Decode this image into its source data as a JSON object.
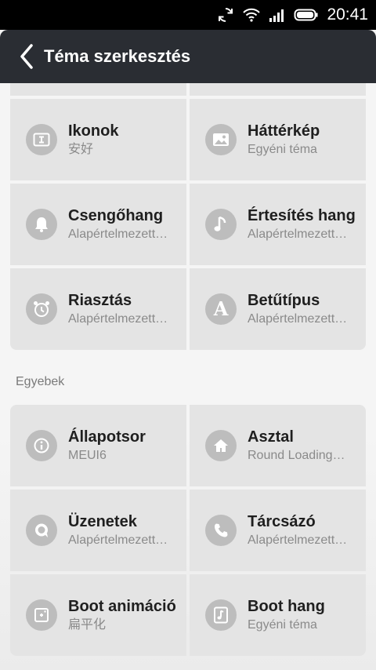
{
  "status_bar": {
    "time": "20:41"
  },
  "header": {
    "title": "Téma szerkesztés"
  },
  "top_group": [
    {
      "name": "",
      "sub": ""
    },
    {
      "name": "",
      "sub": ""
    },
    {
      "name": "Ikonok",
      "sub": "安好",
      "icon": "icons-icon"
    },
    {
      "name": "Háttérkép",
      "sub": "Egyéni téma",
      "icon": "wallpaper-icon"
    },
    {
      "name": "Csengőhang",
      "sub": "Alapértelmezett…",
      "icon": "bell-icon"
    },
    {
      "name": "Értesítés hang",
      "sub": "Alapértelmezett…",
      "icon": "music-note-icon"
    },
    {
      "name": "Riasztás",
      "sub": "Alapértelmezett…",
      "icon": "alarm-clock-icon"
    },
    {
      "name": "Betűtípus",
      "sub": "Alapértelmezett…",
      "icon": "font-icon"
    }
  ],
  "section": {
    "label": "Egyebek"
  },
  "bottom_group": [
    {
      "name": "Állapotsor",
      "sub": "MEUI6",
      "icon": "info-icon"
    },
    {
      "name": "Asztal",
      "sub": "Round Loading…",
      "icon": "home-icon"
    },
    {
      "name": "Üzenetek",
      "sub": "Alapértelmezett…",
      "icon": "message-icon"
    },
    {
      "name": "Tárcsázó",
      "sub": "Alapértelmezett…",
      "icon": "phone-icon"
    },
    {
      "name": "Boot animáció",
      "sub": "扁平化",
      "icon": "boot-animation-icon"
    },
    {
      "name": "Boot hang",
      "sub": "Egyéni téma",
      "icon": "boot-sound-icon"
    }
  ]
}
